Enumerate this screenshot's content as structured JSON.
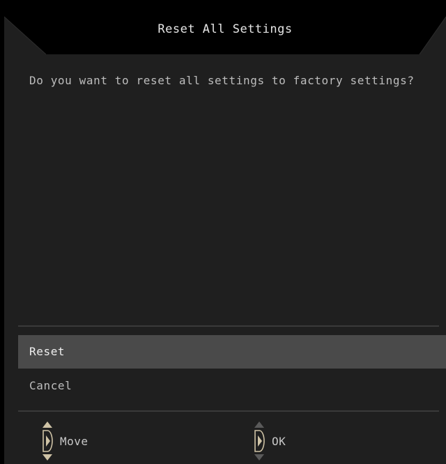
{
  "dialog": {
    "title": "Reset All Settings",
    "message": "Do you want to reset all settings to factory settings?"
  },
  "options": [
    {
      "label": "Reset",
      "selected": true
    },
    {
      "label": "Cancel",
      "selected": false
    }
  ],
  "hints": {
    "move": {
      "label": "Move",
      "icon": "joystick-up-down-icon"
    },
    "ok": {
      "label": "OK",
      "icon": "joystick-press-icon"
    }
  },
  "colors": {
    "panel_background": "#1f1f1f",
    "header_background": "#000000",
    "selected_option_background": "#4a4a4a",
    "accent_icon": "#cfc3a6"
  }
}
